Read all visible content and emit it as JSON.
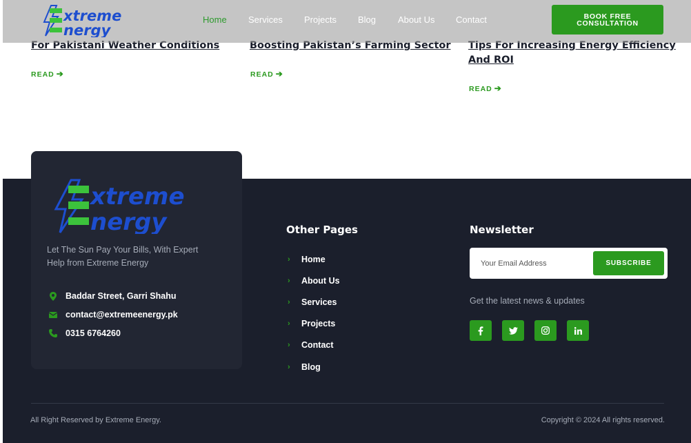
{
  "brand": {
    "logo_text_line1": "xtreme",
    "logo_text_line2": "nergy",
    "logo_letter": "E",
    "primary": "#2b9a1f",
    "logo_blue": "#1d4ecf",
    "footer_bg": "#1b1f2c"
  },
  "nav": {
    "items": [
      "Home",
      "Services",
      "Projects",
      "Blog",
      "About Us",
      "Contact"
    ],
    "active": "Home",
    "cta_line1": "BOOK FREE",
    "cta_line2": "CONSULTATION"
  },
  "posts": [
    {
      "title_line1": "For Pakistani Weather Conditions",
      "title_line2": "",
      "read": "READ"
    },
    {
      "title_line1": "Boosting Pakistan’s Farming Sector",
      "title_line2": "",
      "read": "READ"
    },
    {
      "title_line1": "Tips For Increasing Energy Efficiency",
      "title_line2": "And ROI",
      "read": "READ"
    }
  ],
  "footer": {
    "tagline": "Let The Sun Pay Your Bills, With Expert Help from Extreme Energy",
    "address": "Baddar Street, Garri Shahu",
    "email": "contact@extremeenergy.pk",
    "phone": "0315 6764260",
    "other_pages_title": "Other Pages",
    "other_pages": [
      "Home",
      "About Us",
      "Services",
      "Projects",
      "Contact",
      "Blog"
    ],
    "newsletter_title": "Newsletter",
    "email_placeholder": "Your Email Address",
    "subscribe_label": "SUBSCRIBE",
    "newsletter_sub": "Get the latest news & updates",
    "socials": [
      "facebook-icon",
      "twitter-icon",
      "instagram-icon",
      "linkedin-icon"
    ],
    "copyright_left": "All Right Reserved by Extreme Energy.",
    "copyright_right": "Copyright © 2024 All rights reserved."
  }
}
